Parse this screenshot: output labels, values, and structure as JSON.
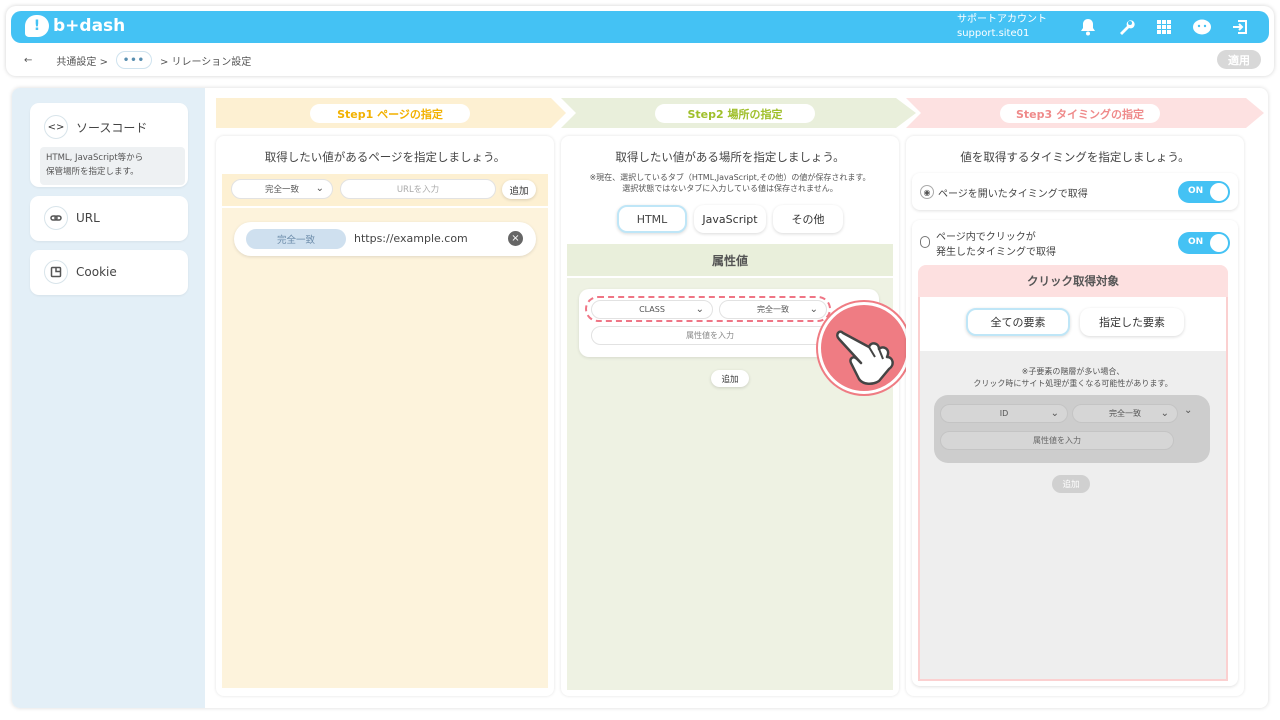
{
  "header": {
    "logo_text": "b+dash",
    "account_line1": "サポートアカウント",
    "account_line2": "support.site01"
  },
  "breadcrumb": {
    "back": "←",
    "item1": "共通設定 >",
    "dots": "•••",
    "item2": "> リレーション設定",
    "apply": "適用"
  },
  "sidebar": {
    "source": {
      "label": "ソースコード",
      "icon": "<>",
      "desc_line1": "HTML, JavaScript等から",
      "desc_line2": "保管場所を指定します。"
    },
    "url": {
      "label": "URL"
    },
    "cookie": {
      "label": "Cookie"
    }
  },
  "steps": {
    "step1": "Step1 ページの指定",
    "step2": "Step2 場所の指定",
    "step3": "Step3 タイミングの指定"
  },
  "col1": {
    "title": "取得したい値があるページを指定しましょう。",
    "match_select": "完全一致",
    "url_placeholder": "URLを入力",
    "add": "追加",
    "entry_match": "完全一致",
    "entry_url": "https://example.com"
  },
  "col2": {
    "title": "取得したい値がある場所を指定しましょう。",
    "note1": "※現在、選択しているタブ（HTML,JavaScript,その他）の値が保存されます。",
    "note2": "選択状態ではないタブに入力している値は保存されません。",
    "tabs": [
      "HTML",
      "JavaScript",
      "その他"
    ],
    "section": "属性値",
    "attr_select": "CLASS",
    "match_select": "完全一致",
    "attr_placeholder": "属性値を入力",
    "add": "追加"
  },
  "col3": {
    "title": "値を取得するタイミングを指定しましょう。",
    "option1": "ページを開いたタイミングで取得",
    "option2_line1": "ページ内でクリックが",
    "option2_line2": "発生したタイミングで取得",
    "toggle": "ON",
    "click_target": "クリック取得対象",
    "tab_all": "全ての要素",
    "tab_specified": "指定した要素",
    "note1": "※子要素の階層が多い場合、",
    "note2": "クリック時にサイト処理が重くなる可能性があります。",
    "id_select": "ID",
    "match_select": "完全一致",
    "attr_placeholder": "属性値を入力",
    "add": "追加"
  },
  "colors": {
    "brand": "#44c2f4",
    "step1": "#fdf2d6",
    "step2": "#eaf0dc",
    "step3": "#fde3e3",
    "accent_pink": "#ef6f7e"
  }
}
